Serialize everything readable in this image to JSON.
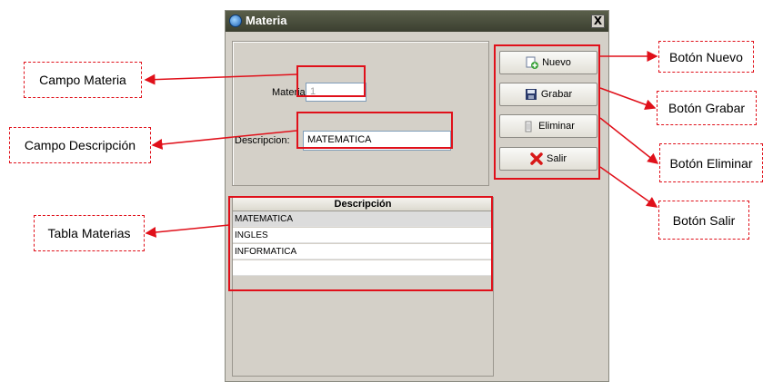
{
  "window": {
    "title": "Materia",
    "close_glyph": "X"
  },
  "form": {
    "materia_label": "Materia:",
    "materia_value": "1",
    "descripcion_label": "Descripcion:",
    "descripcion_value": "MATEMATICA"
  },
  "buttons": {
    "nuevo": "Nuevo",
    "grabar": "Grabar",
    "eliminar": "Eliminar",
    "salir": "Salir"
  },
  "table": {
    "header": "Descripción",
    "rows": [
      "MATEMATICA",
      "INGLES",
      "INFORMATICA"
    ],
    "selected_row": 0
  },
  "annotations": {
    "campo_materia": "Campo Materia",
    "campo_descripcion": "Campo Descripción",
    "tabla_materias": "Tabla Materias",
    "boton_nuevo": "Botón Nuevo",
    "boton_grabar": "Botón Grabar",
    "boton_eliminar": "Botón Eliminar",
    "boton_salir": "Botón Salir"
  },
  "colors": {
    "annotation_red": "#e0101a",
    "window_bg": "#d4d0c8",
    "titlebar": "#4a4f3c"
  },
  "icons": {
    "window": "app-icon",
    "nuevo": "new-document-icon",
    "grabar": "floppy-disk-icon",
    "eliminar": "trash-icon",
    "salir": "red-x-icon"
  }
}
